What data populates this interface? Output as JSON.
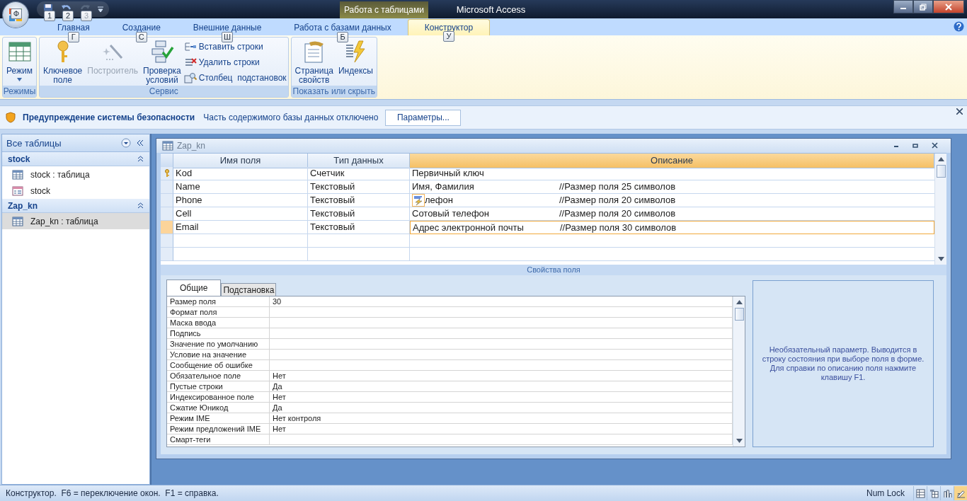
{
  "title_bar": {
    "office_keytip": "Ф",
    "quick_access": [
      {
        "kind": "save",
        "keytip": "1",
        "disabled": false
      },
      {
        "kind": "undo",
        "keytip": "2",
        "disabled": false
      },
      {
        "kind": "redo",
        "keytip": "3",
        "disabled": true
      }
    ],
    "context_tab": "Работа с таблицами",
    "title": "Microsoft Access"
  },
  "tabs": [
    {
      "label": "Главная",
      "keytip": "Г",
      "selected": false
    },
    {
      "label": "Создание",
      "keytip": "С",
      "selected": false
    },
    {
      "label": "Внешние данные",
      "keytip": "Ш",
      "selected": false
    },
    {
      "label": "Работа с базами данных",
      "keytip": "Б",
      "selected": false
    },
    {
      "label": "Конструктор",
      "keytip": "У",
      "selected": true
    }
  ],
  "ribbon": {
    "groups": [
      {
        "label": "Режимы",
        "buttons": [
          {
            "kind": "large",
            "label": "Режим",
            "dropdown": true,
            "disabled": false
          }
        ]
      },
      {
        "label": "Сервис",
        "buttons": [
          {
            "kind": "large",
            "label": "Ключевое\nполе",
            "dropdown": false,
            "disabled": false
          },
          {
            "kind": "large",
            "label": "Построитель",
            "dropdown": false,
            "disabled": true
          },
          {
            "kind": "large",
            "label": "Проверка\nусловий",
            "dropdown": false,
            "disabled": false
          },
          {
            "kind": "small",
            "label": "Вставить строки",
            "dropdown": false,
            "disabled": false
          },
          {
            "kind": "small",
            "label": "Удалить строки",
            "dropdown": false,
            "disabled": false
          },
          {
            "kind": "small",
            "label": "Столбец  подстановок",
            "dropdown": false,
            "disabled": false
          }
        ]
      },
      {
        "label": "Показать или скрыть",
        "buttons": [
          {
            "kind": "large",
            "label": "Страница\nсвойств",
            "dropdown": false,
            "disabled": false
          },
          {
            "kind": "large",
            "label": "Индексы",
            "dropdown": false,
            "disabled": false
          }
        ]
      }
    ]
  },
  "security_bar": {
    "title": "Предупреждение системы безопасности",
    "message": "Часть содержимого базы данных отключено",
    "button": "Параметры..."
  },
  "nav_pane": {
    "header": "Все таблицы",
    "groups": [
      {
        "label": "stock",
        "items": [
          {
            "kind": "table",
            "label": "stock : таблица",
            "selected": false
          },
          {
            "kind": "form",
            "label": "stock",
            "selected": false
          }
        ]
      },
      {
        "label": "Zap_kn",
        "items": [
          {
            "kind": "table",
            "label": "Zap_kn : таблица",
            "selected": true
          }
        ]
      }
    ]
  },
  "document": {
    "title": "Zap_kn",
    "columns": [
      "Имя поля",
      "Тип данных",
      "Описание"
    ],
    "rows": [
      {
        "name": "Kod",
        "type": "Счетчик",
        "description": "Первичный ключ",
        "primary_key": true,
        "selected": false,
        "smart_tag": false
      },
      {
        "name": "Name",
        "type": "Текстовый",
        "description": "Имя, Фамилия",
        "comment": "//Размер поля 25 символов",
        "primary_key": false,
        "selected": false,
        "smart_tag": false
      },
      {
        "name": "Phone",
        "type": "Текстовый",
        "description": "лефон",
        "comment": "//Размер поля 20 символов",
        "primary_key": false,
        "selected": false,
        "smart_tag": true
      },
      {
        "name": "Cell",
        "type": "Текстовый",
        "description": "Сотовый телефон",
        "comment": "//Размер поля 20 символов",
        "primary_key": false,
        "selected": false,
        "smart_tag": false
      },
      {
        "name": "Email",
        "type": "Текстовый",
        "description": "Адрес электронной почты",
        "comment": "//Размер поля 30 символов",
        "primary_key": false,
        "selected": true,
        "smart_tag": false
      }
    ],
    "properties_title": "Свойства поля",
    "property_tabs": [
      {
        "label": "Общие",
        "selected": true
      },
      {
        "label": "Подстановка",
        "selected": false
      }
    ],
    "properties": [
      {
        "label": "Размер поля",
        "value": "30"
      },
      {
        "label": "Формат поля"
      },
      {
        "label": "Маска ввода"
      },
      {
        "label": "Подпись"
      },
      {
        "label": "Значение по умолчанию"
      },
      {
        "label": "Условие на значение"
      },
      {
        "label": "Сообщение об ошибке"
      },
      {
        "label": "Обязательное поле",
        "value": "Нет"
      },
      {
        "label": "Пустые строки",
        "value": "Да"
      },
      {
        "label": "Индексированное поле",
        "value": "Нет"
      },
      {
        "label": "Сжатие Юникод",
        "value": "Да"
      },
      {
        "label": "Режим IME",
        "value": "Нет контроля"
      },
      {
        "label": "Режим предложений IME",
        "value": "Нет"
      },
      {
        "label": "Смарт-теги"
      }
    ],
    "help_text": "Необязательный параметр.  Выводится в строку состояния при выборе поля в форме. Для справки по описанию поля нажмите клавишу F1."
  },
  "status_bar": {
    "text": "Конструктор.  F6 = переключение окон.  F1 = справка.",
    "num_lock": "Num Lock",
    "views": [
      {
        "kind": "datasheet",
        "selected": false
      },
      {
        "kind": "pivot_table",
        "selected": false
      },
      {
        "kind": "pivot_chart",
        "selected": false
      },
      {
        "kind": "design",
        "selected": true
      }
    ]
  }
}
